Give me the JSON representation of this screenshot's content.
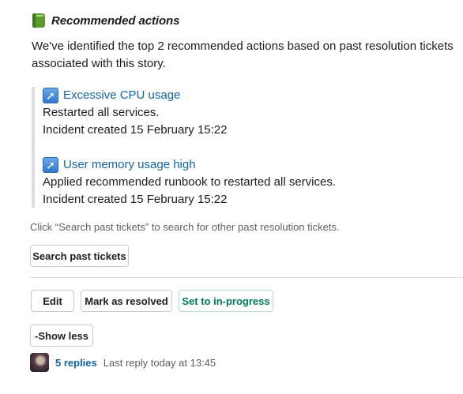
{
  "header": {
    "icon": "green-book-icon",
    "title": "Recommended actions"
  },
  "intro": "We've identified the top 2 recommended actions based on past resolution tickets associated with this story.",
  "actions": [
    {
      "icon": "arrow-up-right-icon",
      "title": "Excessive CPU usage",
      "description": "Restarted all services.",
      "created": "Incident created 15 February 15:22"
    },
    {
      "icon": "arrow-up-right-icon",
      "title": "User memory usage high",
      "description": "Applied recommended runbook to restarted all services.",
      "created": "Incident created 15 February 15:22"
    }
  ],
  "hint": "Click “Search past tickets” to search for other past resolution tickets.",
  "buttons": {
    "search": "Search past tickets",
    "edit": "Edit",
    "resolve": "Mark as resolved",
    "in_progress": "Set to in-progress",
    "show_less": "-Show less"
  },
  "thread": {
    "replies": "5 replies",
    "last_reply": "Last reply today at 13:45"
  },
  "colors": {
    "link": "#1264a3",
    "in_progress": "#007a5a",
    "border": "#dddddd"
  }
}
